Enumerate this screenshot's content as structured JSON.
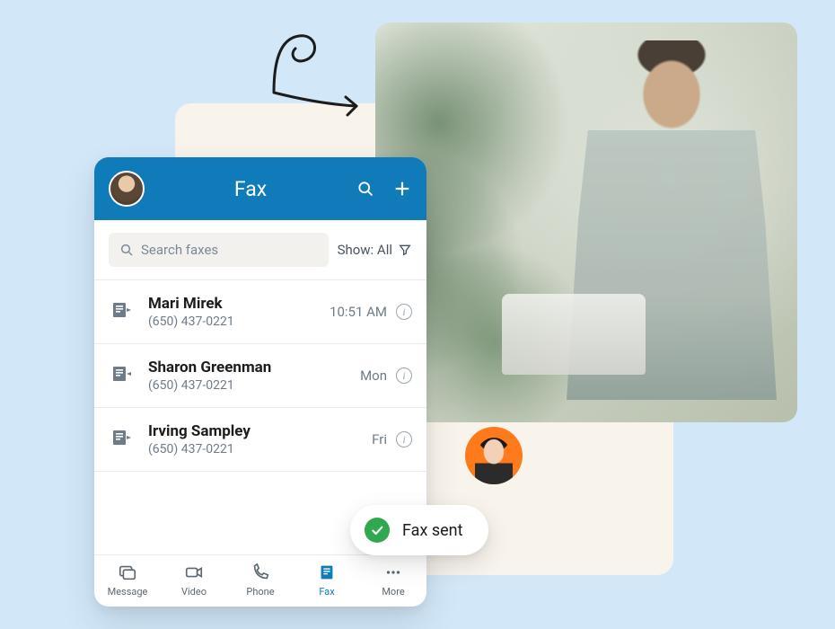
{
  "header": {
    "title": "Fax"
  },
  "search": {
    "placeholder": "Search faxes"
  },
  "filter": {
    "label": "Show: All"
  },
  "faxes": [
    {
      "name": "Mari Mirek",
      "phone": "(650) 437-0221",
      "time": "10:51 AM",
      "direction": "out"
    },
    {
      "name": "Sharon Greenman",
      "phone": "(650) 437-0221",
      "time": "Mon",
      "direction": "in"
    },
    {
      "name": "Irving Sampley",
      "phone": "(650) 437-0221",
      "time": "Fri",
      "direction": "out"
    }
  ],
  "tabs": {
    "message": "Message",
    "video": "Video",
    "phone": "Phone",
    "fax": "Fax",
    "more": "More"
  },
  "toast": {
    "text": "Fax sent"
  }
}
